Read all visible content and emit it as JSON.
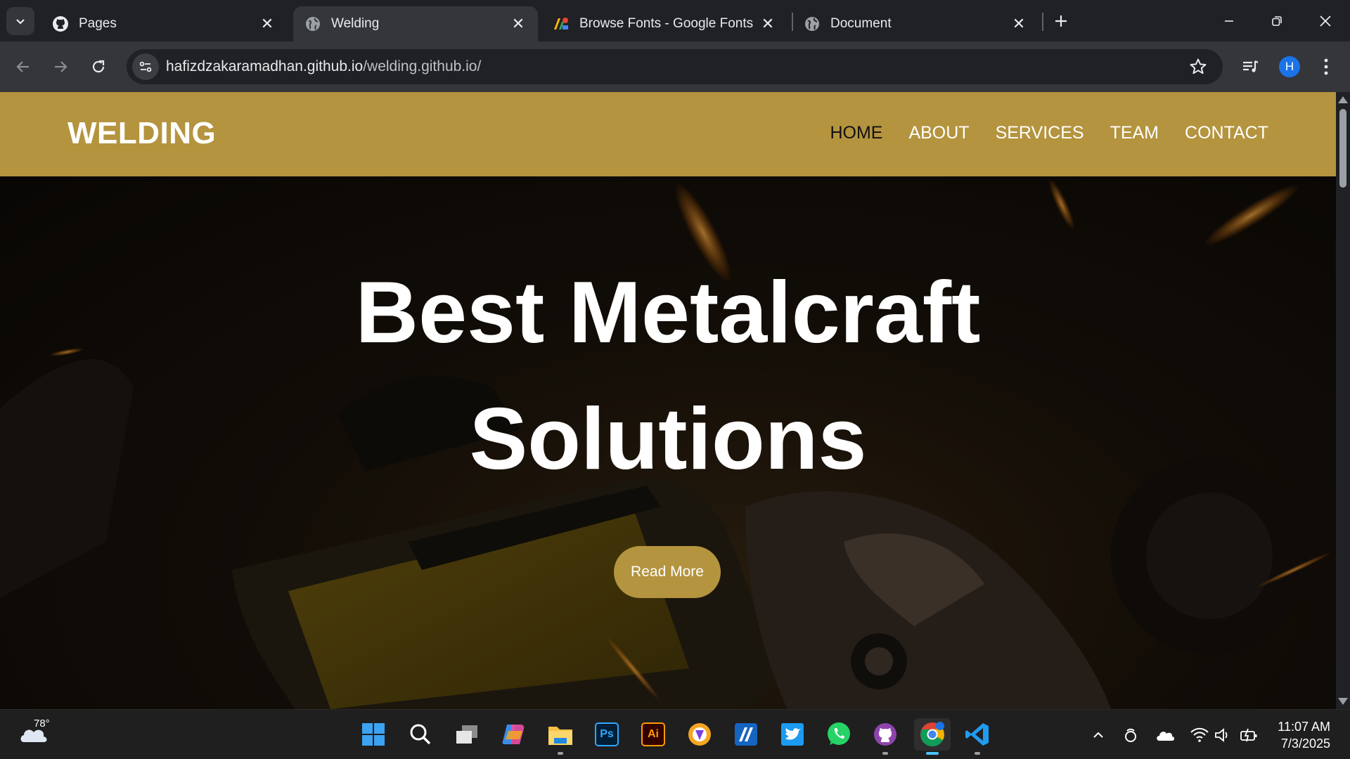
{
  "browser": {
    "tabs": [
      {
        "title": "Pages",
        "icon": "github-icon",
        "active": false
      },
      {
        "title": "Welding",
        "icon": "globe-icon",
        "active": true
      },
      {
        "title": "Browse Fonts - Google Fonts",
        "icon": "google-fonts-icon",
        "active": false
      },
      {
        "title": "Document",
        "icon": "globe-icon",
        "active": false
      }
    ],
    "url_host": "hafizdzakaramadhan.github.io",
    "url_path": "/welding.github.io/",
    "profile_initial": "H"
  },
  "site": {
    "logo": "WELDING",
    "nav": [
      "HOME",
      "ABOUT",
      "SERVICES",
      "TEAM",
      "CONTACT"
    ],
    "hero_line1": "Best Metalcraft",
    "hero_line2": "Solutions",
    "cta": "Read More",
    "accent": "#b4943e"
  },
  "taskbar": {
    "weather_temp": "78°",
    "time": "11:07 AM",
    "date": "7/3/2025",
    "apps": [
      "start-icon",
      "search-icon",
      "task-view-icon",
      "copilot-icon",
      "file-explorer-icon",
      "photoshop-icon",
      "illustrator-icon",
      "brave-icon",
      "vpn-icon",
      "twitter-icon",
      "whatsapp-icon",
      "github-desktop-icon",
      "chrome-icon",
      "vscode-icon"
    ],
    "ps_label": "Ps",
    "ai_label": "Ai"
  }
}
